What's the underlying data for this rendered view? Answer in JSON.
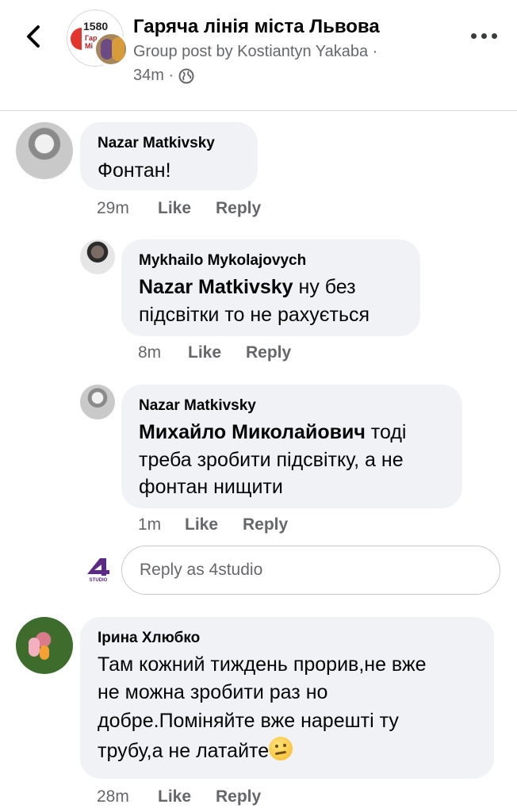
{
  "header": {
    "title": "Гаряча лінія міста Львова",
    "subtitle": "Group post by Kostiantyn Yakaba ·",
    "time": "34m ·",
    "group_avatar_number": "1580",
    "group_avatar_line1": "Гар",
    "group_avatar_line2": "Мі",
    "icons": [
      "back-icon",
      "globe-icon",
      "more-icon"
    ]
  },
  "comments": [
    {
      "author": "Nazar Matkivsky",
      "text": "Фонтан!",
      "time": "29m",
      "like": "Like",
      "reply": "Reply"
    },
    {
      "author": "Mykhailo Mykolajovych",
      "mention": "Nazar Matkivsky",
      "text_line1": "ну без",
      "text_line2": "підсвітки то не рахується",
      "time": "8m",
      "like": "Like",
      "reply": "Reply"
    },
    {
      "author": "Nazar Matkivsky",
      "mention": "Михайло Миколайович",
      "text_line1": "тоді",
      "text_line2": "треба зробити підсвітку, а не",
      "text_line3": "фонтан нищити",
      "time": "1m",
      "like": "Like",
      "reply": "Reply"
    },
    {
      "author": "Ірина Хлюбко",
      "text_line1": "Там кожний тиждень прорив,не вже",
      "text_line2": "не можна зробити раз но",
      "text_line3": "добре.Поміняйте вже нарешті ту",
      "text_line4": "трубу,а не латайте",
      "time": "28m",
      "like": "Like",
      "reply": "Reply"
    }
  ],
  "reply_box": {
    "placeholder": "Reply as 4studio",
    "logo_text": "4",
    "logo_subtext": "STUDIO"
  },
  "colors": {
    "bubble": "#f0f2f5",
    "meta": "#65676b",
    "text": "#050505",
    "logo": "#5b2a86"
  }
}
